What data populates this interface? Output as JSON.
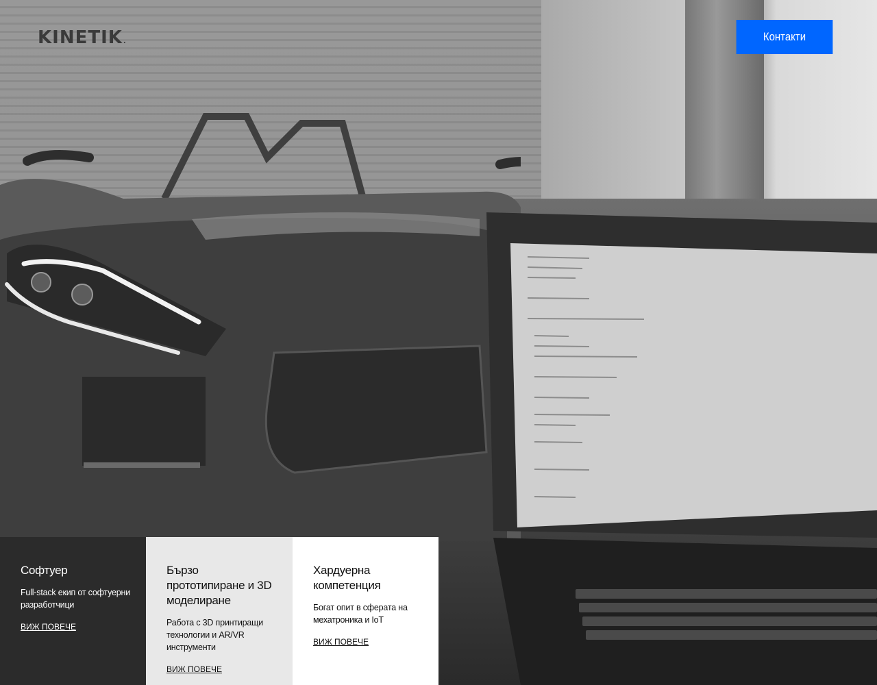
{
  "brand": {
    "logo_text": "KINETIK",
    "logo_mark": "."
  },
  "header": {
    "contact_label": "Контакти"
  },
  "cards": [
    {
      "title": "Софтуер",
      "description": "Full-stack екип от софтуерни разработчици",
      "link": "ВИЖ ПОВЕЧЕ"
    },
    {
      "title": "Бързо прототипиране и 3D моделиране",
      "description": "Работа с 3D принтиращи технологии и AR/VR инструменти",
      "link": "ВИЖ ПОВЕЧЕ"
    },
    {
      "title": "Хардуерна компетенция",
      "description": "Богат опит в сферата на мехатроника и IoT",
      "link": "ВИЖ ПОВЕЧЕ"
    }
  ],
  "colors": {
    "accent": "#0066ff",
    "card_dark": "#2b2b2b",
    "card_light": "#e8e8e8",
    "card_white": "#ffffff"
  },
  "icons": {
    "hero_image": "car-and-laptop-photo"
  }
}
